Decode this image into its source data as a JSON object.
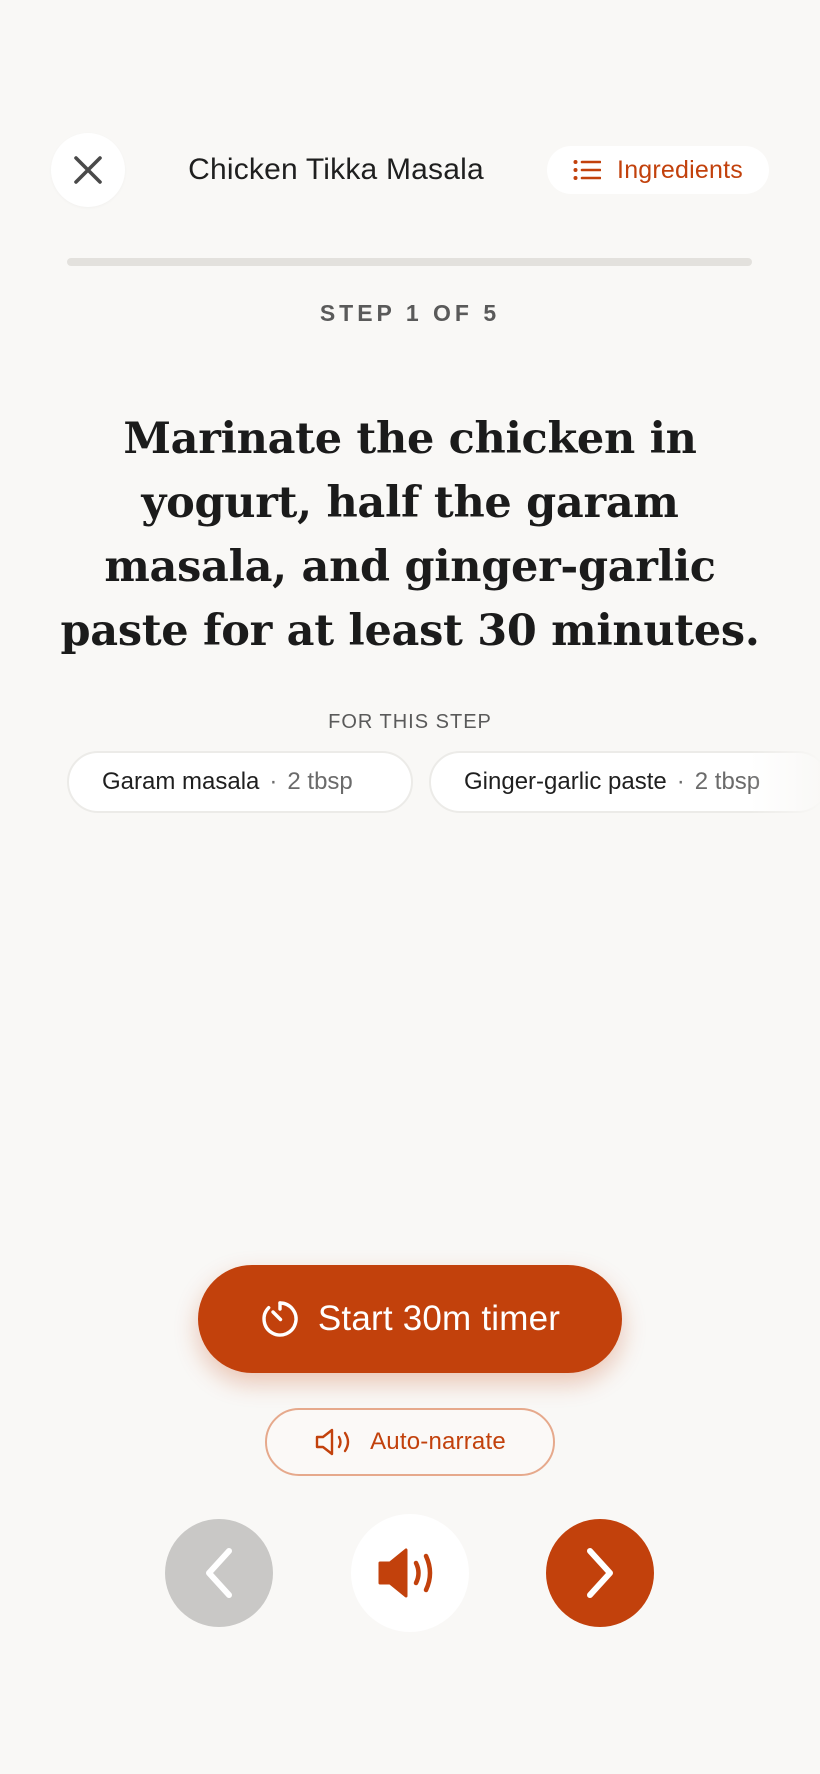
{
  "header": {
    "title": "Chicken Tikka Masala",
    "ingredients_label": "Ingredients"
  },
  "progress": {
    "step_label": "STEP 1 OF 5",
    "current_step": 1,
    "total_steps": 5,
    "fill_fraction": 0
  },
  "step": {
    "instruction": "Marinate the chicken in yogurt, half the garam masala, and ginger-garlic paste for at least 30 minutes.",
    "for_step_label": "FOR THIS STEP",
    "ingredients": [
      {
        "name": "Garam masala",
        "quantity": "2 tbsp"
      },
      {
        "name": "Ginger-garlic paste",
        "quantity": "2 tbsp"
      }
    ]
  },
  "actions": {
    "timer_label": "Start 30m timer",
    "narrate_label": "Auto-narrate"
  },
  "colors": {
    "accent": "#c2410c",
    "background": "#f9f8f6",
    "disabled": "#c9c8c6"
  },
  "icons": {
    "close": "close-icon",
    "ingredients": "list-icon",
    "timer": "timer-icon",
    "narrate": "speaker-outline-icon",
    "prev": "chevron-left-icon",
    "speak": "speaker-filled-icon",
    "next": "chevron-right-icon"
  }
}
